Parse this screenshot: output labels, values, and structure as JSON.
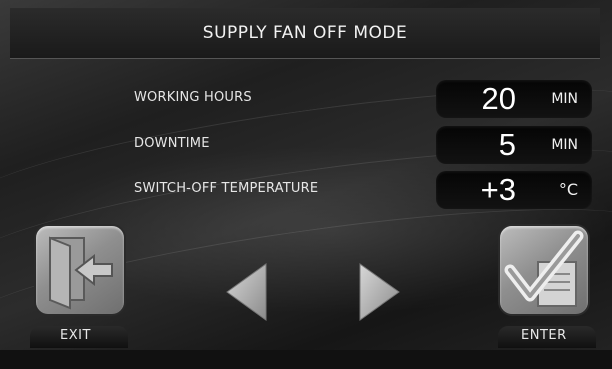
{
  "header": {
    "title": "SUPPLY FAN OFF MODE"
  },
  "settings": [
    {
      "label": "WORKING HOURS",
      "value": "20",
      "unit": "MIN"
    },
    {
      "label": "DOWNTIME",
      "value": "5",
      "unit": "MIN"
    },
    {
      "label": "SWITCH-OFF TEMPERATURE",
      "value": "+3",
      "unit": "°C"
    }
  ],
  "footer": {
    "exit_label": "EXIT",
    "enter_label": "ENTER",
    "exit_icon": "exit-door-icon",
    "enter_icon": "checkmark-icon",
    "prev_icon": "arrow-left-icon",
    "next_icon": "arrow-right-icon"
  }
}
